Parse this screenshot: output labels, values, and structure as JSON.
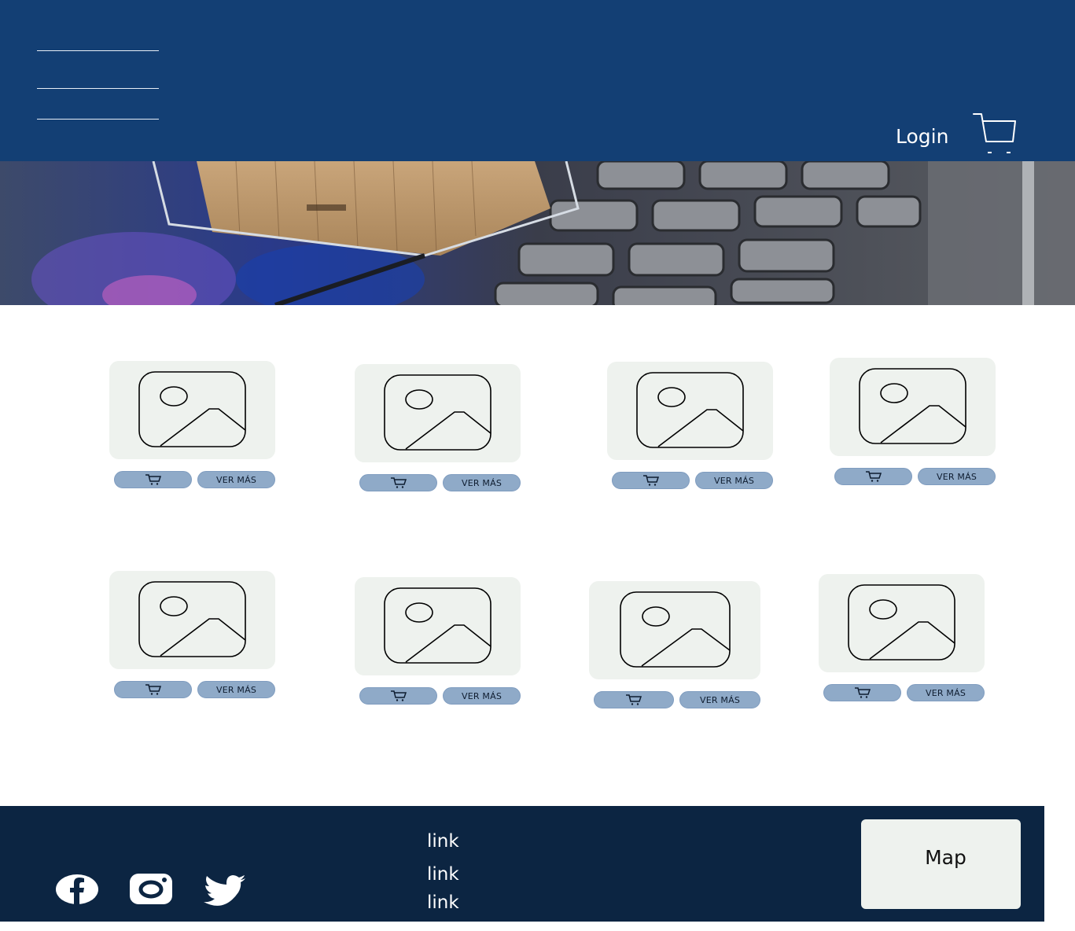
{
  "header": {
    "login_label": "Login",
    "cart_icon": "cart-icon",
    "background": "#133f74"
  },
  "products": [
    {
      "more_label": "VER MÁS"
    },
    {
      "more_label": "VER MÁS"
    },
    {
      "more_label": "VER MÁS"
    },
    {
      "more_label": "VER MÁS"
    },
    {
      "more_label": "VER MÁS"
    },
    {
      "more_label": "VER MÁS"
    },
    {
      "more_label": "VER MÁS"
    },
    {
      "more_label": "VER MÁS"
    }
  ],
  "footer": {
    "links": [
      "link",
      "link",
      "link"
    ],
    "map_label": "Map",
    "social_icons": [
      "facebook-icon",
      "instagram-icon",
      "twitter-icon"
    ],
    "background": "#0c2542"
  },
  "colors": {
    "button": "#8faac8",
    "card": "#eef2ee"
  }
}
